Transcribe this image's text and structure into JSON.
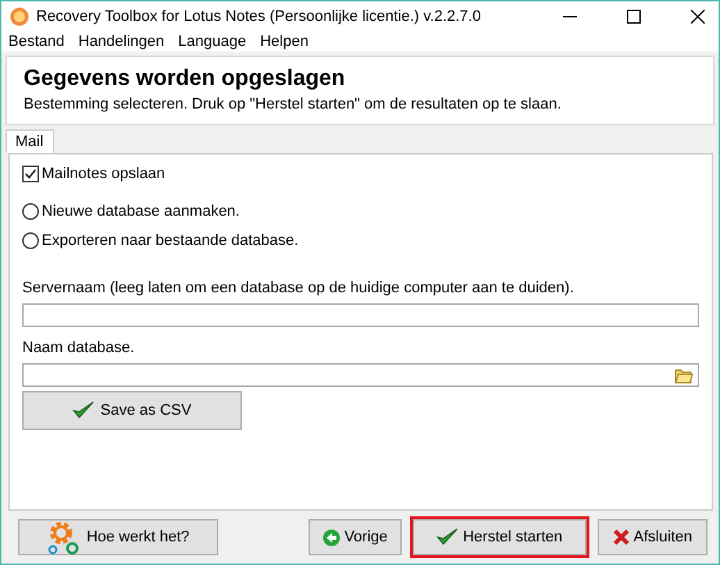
{
  "window": {
    "title": "Recovery Toolbox for Lotus Notes (Persoonlijke licentie.) v.2.2.7.0"
  },
  "menu": [
    "Bestand",
    "Handelingen",
    "Language",
    "Helpen"
  ],
  "header": {
    "title": "Gegevens worden opgeslagen",
    "subtitle": "Bestemming selecteren. Druk op \"Herstel starten\" om de resultaten op te slaan."
  },
  "tabs": [
    {
      "label": "Mail",
      "selected": true
    }
  ],
  "options": [
    {
      "kind": "checkbox",
      "label": "Mailnotes opslaan",
      "checked": true
    },
    {
      "kind": "radio",
      "label": "Nieuwe database aanmaken.",
      "selected": false
    },
    {
      "kind": "radio",
      "label": "Exporteren naar bestaande database.",
      "selected": false
    }
  ],
  "fields": [
    {
      "label": "Servernaam (leeg laten om een database op de huidige computer aan te duiden).",
      "browse": false
    },
    {
      "label": "Naam database.",
      "browse": true
    }
  ],
  "csv_button": "Save as CSV",
  "buttons": [
    {
      "label": "Hoe werkt het?",
      "kind": "help",
      "highlighted": false
    },
    {
      "label": "Vorige",
      "kind": "back",
      "highlighted": false
    },
    {
      "label": "Herstel starten",
      "kind": "start",
      "highlighted": true
    },
    {
      "label": "Afsluiten",
      "kind": "exit",
      "highlighted": false
    }
  ]
}
